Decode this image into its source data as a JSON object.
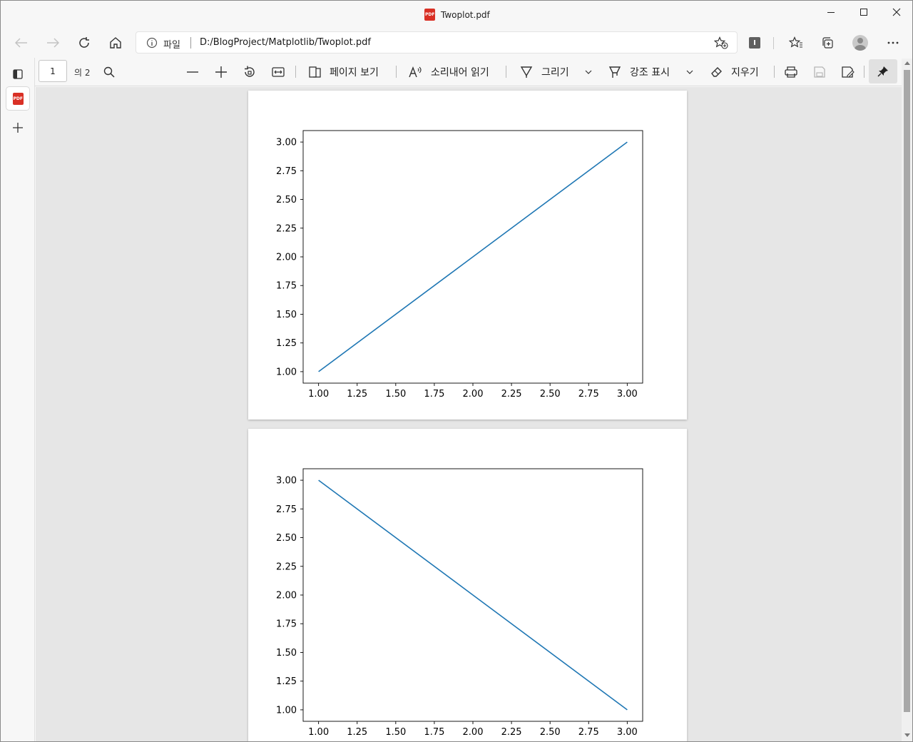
{
  "window": {
    "title": "Twoplot.pdf",
    "controls": {
      "minimize_icon": "minimize-icon",
      "maximize_icon": "maximize-icon",
      "close_icon": "close-icon"
    }
  },
  "navigation": {
    "protocol_label": "파일",
    "url": "D:/BlogProject/Matplotlib/Twoplot.pdf",
    "extension_badge": "I"
  },
  "pdf_toolbar": {
    "current_page": "1",
    "page_of": "의 2",
    "page_view_label": "페이지 보기",
    "read_aloud_label": "소리내어 읽기",
    "draw_label": "그리기",
    "highlight_label": "강조 표시",
    "erase_label": "지우기"
  },
  "colors": {
    "line": "#1f77b4",
    "viewer_bg": "#e6e6e6",
    "toolbar_bg": "#f7f7f7"
  },
  "chart_data": [
    {
      "type": "line",
      "title": "",
      "xlabel": "",
      "ylabel": "",
      "x": [
        1.0,
        2.0,
        3.0
      ],
      "series": [
        {
          "values": [
            1.0,
            2.0,
            3.0
          ]
        }
      ],
      "xlim": [
        0.9,
        3.1
      ],
      "ylim": [
        0.9,
        3.1
      ],
      "xticks": [
        "1.00",
        "1.25",
        "1.50",
        "1.75",
        "2.00",
        "2.25",
        "2.50",
        "2.75",
        "3.00"
      ],
      "yticks": [
        "1.00",
        "1.25",
        "1.50",
        "1.75",
        "2.00",
        "2.25",
        "2.50",
        "2.75",
        "3.00"
      ],
      "grid": false,
      "legend": false
    },
    {
      "type": "line",
      "title": "",
      "xlabel": "",
      "ylabel": "",
      "x": [
        1.0,
        2.0,
        3.0
      ],
      "series": [
        {
          "values": [
            3.0,
            2.0,
            1.0
          ]
        }
      ],
      "xlim": [
        0.9,
        3.1
      ],
      "ylim": [
        0.9,
        3.1
      ],
      "xticks": [
        "1.00",
        "1.25",
        "1.50",
        "1.75",
        "2.00",
        "2.25",
        "2.50",
        "2.75",
        "3.00"
      ],
      "yticks": [
        "1.00",
        "1.25",
        "1.50",
        "1.75",
        "2.00",
        "2.25",
        "2.50",
        "2.75",
        "3.00"
      ],
      "grid": false,
      "legend": false
    }
  ]
}
